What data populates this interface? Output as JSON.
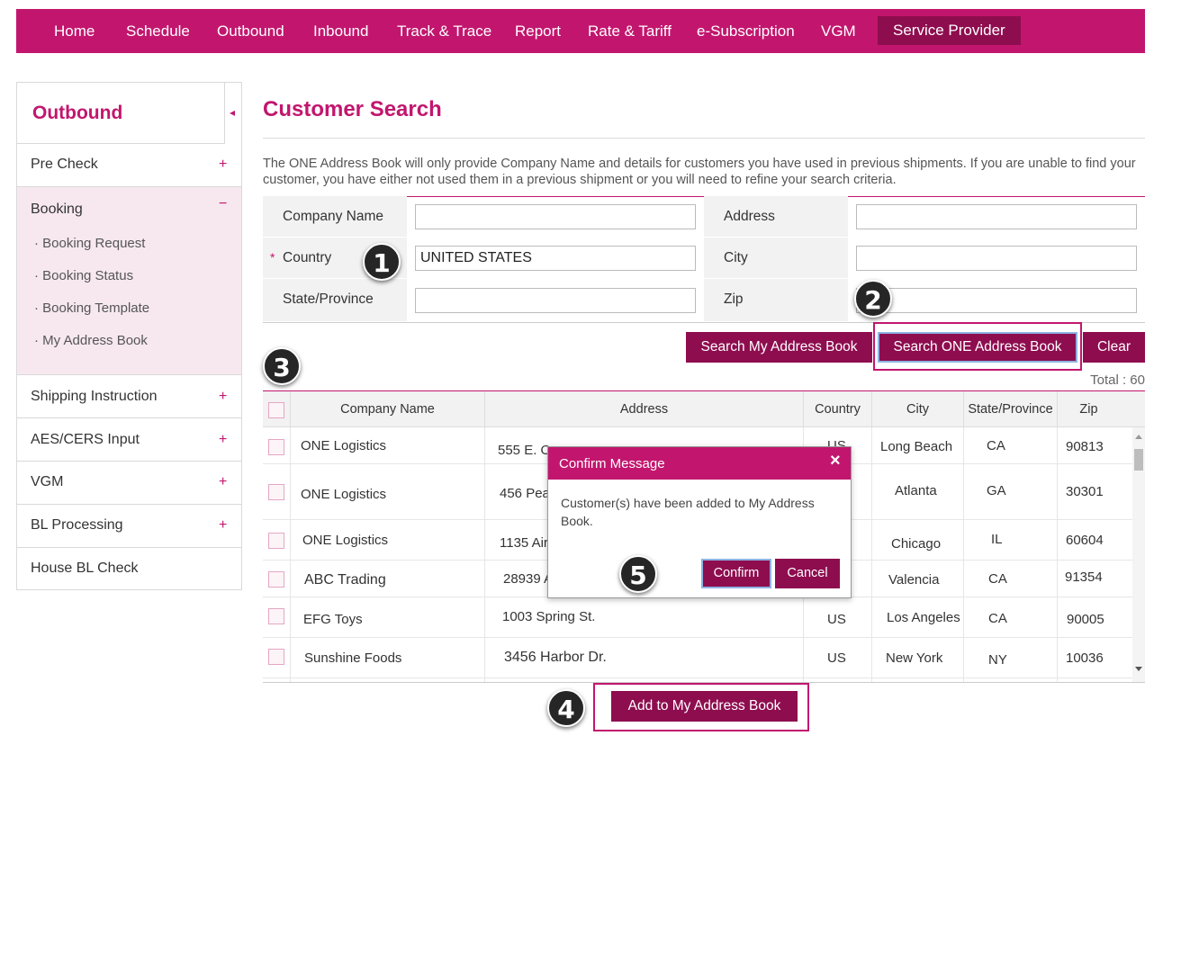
{
  "nav": {
    "items": [
      {
        "label": "Home"
      },
      {
        "label": "Schedule"
      },
      {
        "label": "Outbound"
      },
      {
        "label": "Inbound"
      },
      {
        "label": "Track & Trace"
      },
      {
        "label": "Report"
      },
      {
        "label": "Rate & Tariff"
      },
      {
        "label": "e-Subscription"
      },
      {
        "label": "VGM"
      },
      {
        "label": "Service Provider"
      }
    ]
  },
  "sidebar": {
    "title": "Outbound",
    "collapse_icon": "◂",
    "items": [
      {
        "label": "Pre Check",
        "sign": "+"
      },
      {
        "label": "Booking",
        "sign": "−"
      },
      {
        "label": "Shipping Instruction",
        "sign": "+"
      },
      {
        "label": "AES/CERS Input",
        "sign": "+"
      },
      {
        "label": "VGM",
        "sign": "+"
      },
      {
        "label": "BL Processing",
        "sign": "+"
      },
      {
        "label": "House BL Check"
      }
    ],
    "booking_sub": [
      "Booking Request",
      "Booking Status",
      "Booking Template",
      "My Address Book"
    ]
  },
  "page": {
    "title": "Customer Search",
    "notice": "The ONE Address Book will only provide Company Name and details for customers you have used in previous shipments. If you are unable to find your customer, you have either not used them in a previous shipment or you will need to refine your search criteria."
  },
  "form": {
    "company_label": "Company Name",
    "company_value": "",
    "address_label": "Address",
    "address_value": "",
    "country_label": "Country",
    "country_value": "UNITED STATES",
    "required_mark": "*",
    "city_label": "City",
    "city_value": "",
    "state_label": "State/Province",
    "state_value": "",
    "zip_label": "Zip",
    "zip_value": ""
  },
  "buttons": {
    "search_my": "Search My Address Book",
    "search_one": "Search ONE Address Book",
    "clear": "Clear",
    "add": "Add to My Address Book"
  },
  "results": {
    "total": "Total : 60",
    "headers": [
      "Company Name",
      "Address",
      "Country",
      "City",
      "State/Province",
      "Zip"
    ],
    "rows": [
      {
        "company": "ONE Logistics",
        "address": "555 E. O",
        "country": "US",
        "city": "Long Beach",
        "state": "CA",
        "zip": "90813"
      },
      {
        "company": "ONE Logistics",
        "address": "456 Pea",
        "country": "",
        "city": "Atlanta",
        "state": "GA",
        "zip": "30301"
      },
      {
        "company": "ONE Logistics",
        "address": "1135 Air",
        "country": "",
        "city": "Chicago",
        "state": "IL",
        "zip": "60604"
      },
      {
        "company": "ABC Trading",
        "address": "28939 A",
        "country": "",
        "city": "Valencia",
        "state": "CA",
        "zip": "91354"
      },
      {
        "company": "EFG Toys",
        "address": "1003 Spring St.",
        "country": "US",
        "city": "Los Angeles",
        "state": "CA",
        "zip": "90005"
      },
      {
        "company": "Sunshine Foods",
        "address": "3456 Harbor Dr.",
        "country": "US",
        "city": "New York",
        "state": "NY",
        "zip": "10036"
      }
    ]
  },
  "modal": {
    "title": "Confirm Message",
    "close": "×",
    "message": "Customer(s) have been added to My Address Book.",
    "confirm": "Confirm",
    "cancel": "Cancel"
  },
  "badges": [
    "1",
    "2",
    "3",
    "4",
    "5"
  ],
  "colors": {
    "brand": "#c2166e",
    "button": "#8e0d4f"
  }
}
